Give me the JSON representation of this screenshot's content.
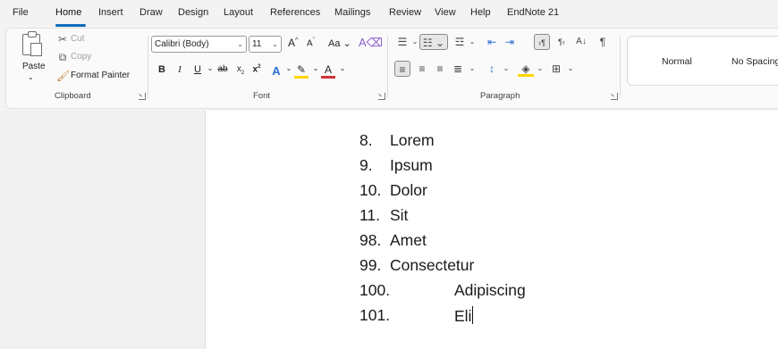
{
  "menu": {
    "tabs": [
      "File",
      "Home",
      "Insert",
      "Draw",
      "Design",
      "Layout",
      "References",
      "Mailings",
      "Review",
      "View",
      "Help",
      "EndNote 21"
    ],
    "active": "Home"
  },
  "clipboard": {
    "paste": "Paste",
    "cut": "Cut",
    "copy": "Copy",
    "format_painter": "Format Painter",
    "group_label": "Clipboard"
  },
  "font": {
    "family": "Calibri (Body)",
    "size": "11",
    "group_label": "Font"
  },
  "paragraph": {
    "group_label": "Paragraph"
  },
  "styles": {
    "items": [
      "Normal",
      "No Spacing"
    ]
  },
  "document": {
    "lines": [
      {
        "num": "8.",
        "text": "Lorem"
      },
      {
        "num": "9.",
        "text": "Ipsum"
      },
      {
        "num": "10.",
        "text": "Dolor"
      },
      {
        "num": "11.",
        "text": "Sit"
      },
      {
        "num": "98.",
        "text": "Amet"
      },
      {
        "num": "99.",
        "text": "Consectetur"
      },
      {
        "num": "100.",
        "text": "Adipiscing"
      },
      {
        "num": "101.",
        "text": "Eli"
      }
    ]
  },
  "colors": {
    "accent": "#0f6cbd",
    "highlight": "#ffd500",
    "font_color": "#d13438"
  }
}
